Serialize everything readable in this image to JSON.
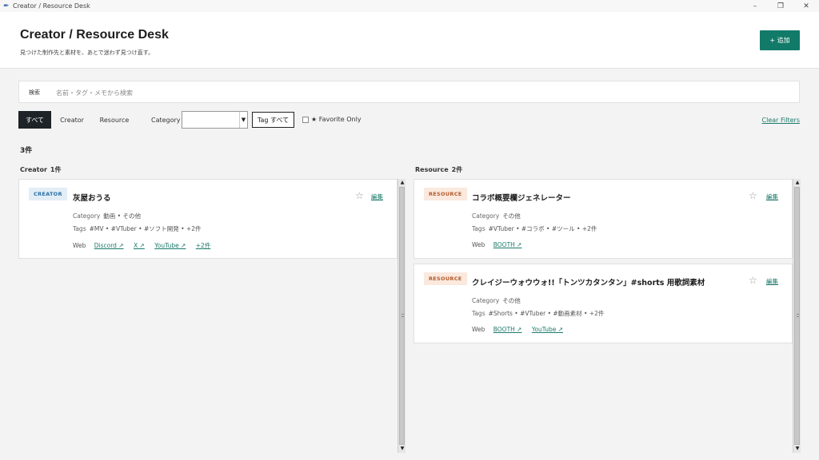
{
  "window": {
    "title": "Creator / Resource Desk",
    "minimize": "–",
    "restore": "❐",
    "close": "✕"
  },
  "header": {
    "title": "Creator / Resource Desk",
    "subtitle": "見つけた制作先と素材を、あとで迷わず見つけ直す。",
    "add_label": "+ 追加"
  },
  "search": {
    "label": "検索",
    "placeholder": "名前・タグ・メモから検索",
    "value": ""
  },
  "filters": {
    "segments": [
      {
        "label": "すべて",
        "active": true
      },
      {
        "label": "Creator",
        "active": false
      },
      {
        "label": "Resource",
        "active": false
      }
    ],
    "category_label": "Category",
    "category_value": "",
    "tag_label": "Tag すべて",
    "favorite_label": "★ Favorite Only",
    "favorite_checked": false,
    "clear_label": "Clear Filters"
  },
  "count_label": "3件",
  "columns": {
    "creator": {
      "title": "Creator",
      "count": "1件"
    },
    "resource": {
      "title": "Resource",
      "count": "2件"
    }
  },
  "cards": {
    "c1": {
      "badge": "CREATOR",
      "name": "灰屋おうる",
      "category_key": "Category",
      "category": "動画 • その他",
      "tags_key": "Tags",
      "tags": "#MV • #VTuber • #ソフト開発 • +2件",
      "web_key": "Web",
      "links": [
        "Discord ↗",
        "X ↗",
        "YouTube ↗",
        "+2件"
      ],
      "edit": "編集",
      "star": "☆"
    },
    "r1": {
      "badge": "RESOURCE",
      "name": "コラボ概要欄ジェネレーター",
      "category_key": "Category",
      "category": "その他",
      "tags_key": "Tags",
      "tags": "#VTuber • #コラボ • #ツール • +2件",
      "web_key": "Web",
      "links": [
        "BOOTH ↗"
      ],
      "edit": "編集",
      "star": "☆"
    },
    "r2": {
      "badge": "RESOURCE",
      "name": "クレイジーウォウウォ!!「トンツカタンタン」#shorts 用歌詞素材",
      "category_key": "Category",
      "category": "その他",
      "tags_key": "Tags",
      "tags": "#Shorts • #VTuber • #動画素材 • +2件",
      "web_key": "Web",
      "links": [
        "BOOTH ↗",
        "YouTube ↗"
      ],
      "edit": "編集",
      "star": "☆"
    }
  },
  "icons": {
    "app": "feather-icon",
    "scroll_up": "▲",
    "scroll_down": "▼",
    "dropdown": "▼"
  },
  "colors": {
    "accent": "#127a69",
    "dark": "#1d2327",
    "creator_badge": "#2a6fa8",
    "resource_badge": "#b45a2a"
  }
}
